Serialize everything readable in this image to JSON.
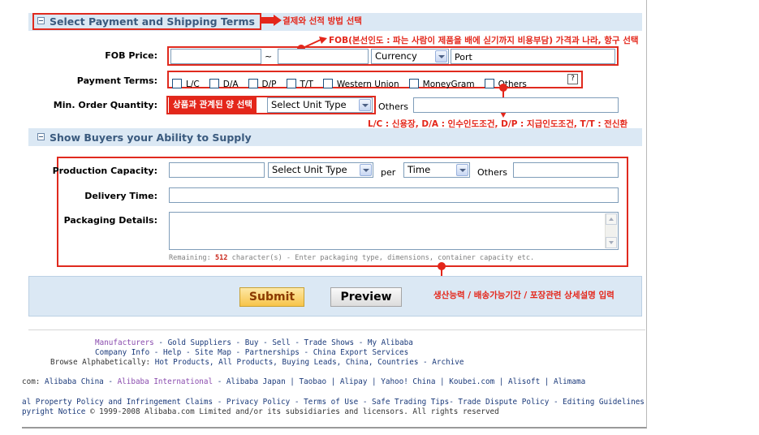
{
  "payment_section": {
    "title": "Select Payment and Shipping Terms",
    "fob_label": "FOB Price:",
    "fob_tilde": "~",
    "currency_select": "Currency",
    "port_label": "Port",
    "payment_terms_label": "Payment Terms:",
    "payment_terms": [
      "L/C",
      "D/A",
      "D/P",
      "T/T",
      "Western Union",
      "MoneyGram",
      "Others"
    ],
    "help_icon_text": "?",
    "min_order_label": "Min. Order Quantity:",
    "unit_type_select": "Select Unit Type",
    "others_label": "Others"
  },
  "supply_section": {
    "title": "Show Buyers your Ability to Supply",
    "production_label": "Production Capacity:",
    "unit_type_select": "Select Unit Type",
    "per_label": "per",
    "time_select": "Time",
    "others_label": "Others",
    "delivery_label": "Delivery Time:",
    "packaging_label": "Packaging Details:",
    "remaining_prefix": "Remaining:",
    "remaining_count": "512",
    "remaining_suffix": "character(s) - Enter packaging type, dimensions, container capacity etc."
  },
  "buttons": {
    "submit": "Submit",
    "preview": "Preview"
  },
  "annotations": {
    "payment_title": "결제와 선적 방법 선택",
    "fob": "FOB(본선인도 : 파는 사람이 제품을 배에 싣기까지 비용부담) 가격과 나라, 항구 선택",
    "unit": "상품과 관계된 양 선택",
    "payment_terms": "L/C : 신용장,  D/A : 인수인도조건,  D/P : 지급인도조건,  T/T : 전신환",
    "supply": "생산능력 / 배송가능기간 / 포장관련 상세설명 입력"
  },
  "footer": {
    "line1": [
      "Manufacturers",
      "Gold Suppliers",
      "Buy",
      "Sell",
      "Trade Shows",
      "My Alibaba"
    ],
    "line2": [
      "Company Info",
      "Help",
      "Site Map",
      "Partnerships",
      "China Export Services"
    ],
    "line3_prefix": "Browse Alphabetically:",
    "line3": [
      "Hot Products",
      "All Products",
      "Buying Leads",
      "China",
      "Countries",
      "Archive"
    ],
    "line4_prefix": "com:",
    "line4": [
      "Alibaba China",
      "Alibaba International",
      "Alibaba Japan",
      "Taobao",
      "Alipay",
      "Yahoo! China",
      "Koubei.com",
      "Alisoft",
      "Alimama"
    ],
    "line5": [
      "al Property Policy and Infringement Claims",
      "Privacy Policy",
      "Terms of Use",
      "Safe Trading Tips",
      "Trade Dispute Policy",
      "Editing Guidelines"
    ],
    "line6_link": "pyright Notice",
    "line6_text": "© 1999-2008 Alibaba.com Limited and/or its subsidiaries and licensors. All rights reserved"
  },
  "colors": {
    "section_bar": "#dbe8f4",
    "section_title": "#3a5a7e",
    "annotation_red": "#e4261a",
    "footer_link": "#1b3a7a",
    "footer_purple": "#8a4cae"
  }
}
